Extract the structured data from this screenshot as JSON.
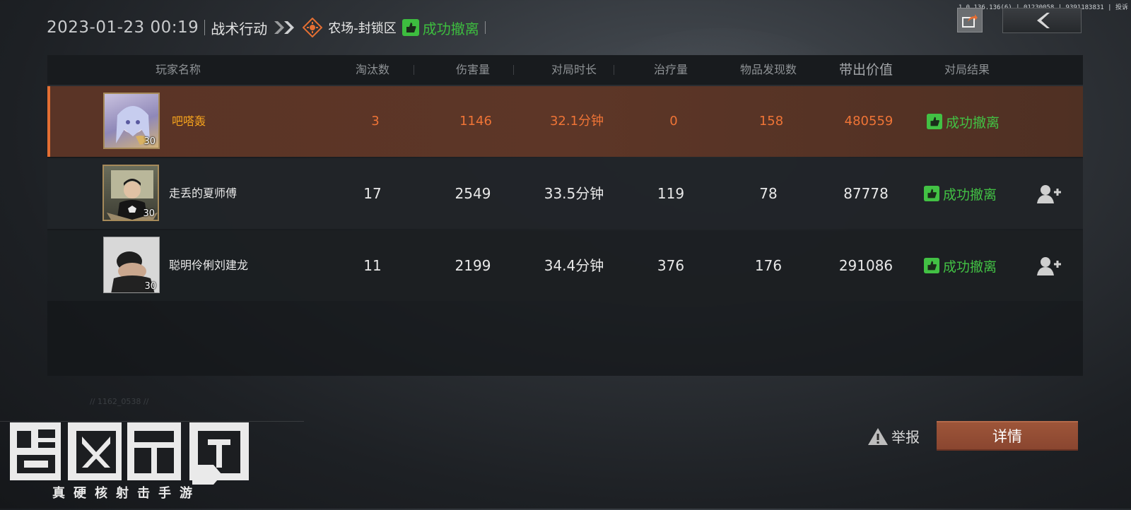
{
  "version": "1.0.136.136(6) | 01230058 | 9391183831 | 投诉",
  "header": {
    "date": "2023-01-23 00:19",
    "mode": "战术行动",
    "map": "农场-封锁区",
    "result": "成功撤离"
  },
  "columns": [
    "玩家名称",
    "淘汰数",
    "伤害量",
    "对局时长",
    "治疗量",
    "物品发现数",
    "带出价值",
    "对局结果"
  ],
  "players": [
    {
      "name": "吧嗒轰",
      "level": "30",
      "kills": "3",
      "damage": "1146",
      "duration": "32.1分钟",
      "heal": "0",
      "items": "158",
      "value": "480559",
      "result": "成功撤离"
    },
    {
      "name": "走丢的夏师傅",
      "level": "30",
      "kills": "17",
      "damage": "2549",
      "duration": "33.5分钟",
      "heal": "119",
      "items": "78",
      "value": "87778",
      "result": "成功撤离"
    },
    {
      "name": "聪明伶俐刘建龙",
      "level": "30",
      "kills": "11",
      "damage": "2199",
      "duration": "34.4分钟",
      "heal": "376",
      "items": "176",
      "value": "291086",
      "result": "成功撤离"
    }
  ],
  "footer": {
    "id_text": "// 1162_0538 //",
    "logo_subtitle": "真硬核射击手游",
    "report": "举报",
    "detail": "详情"
  },
  "colors": {
    "accent": "#e46f33",
    "success": "#42c144",
    "highlight_name": "#f4a21d"
  },
  "icons": [
    "share-icon",
    "back-arrow-icon",
    "map-marker-icon",
    "evac-success-icon",
    "add-friend-icon",
    "warning-icon"
  ]
}
